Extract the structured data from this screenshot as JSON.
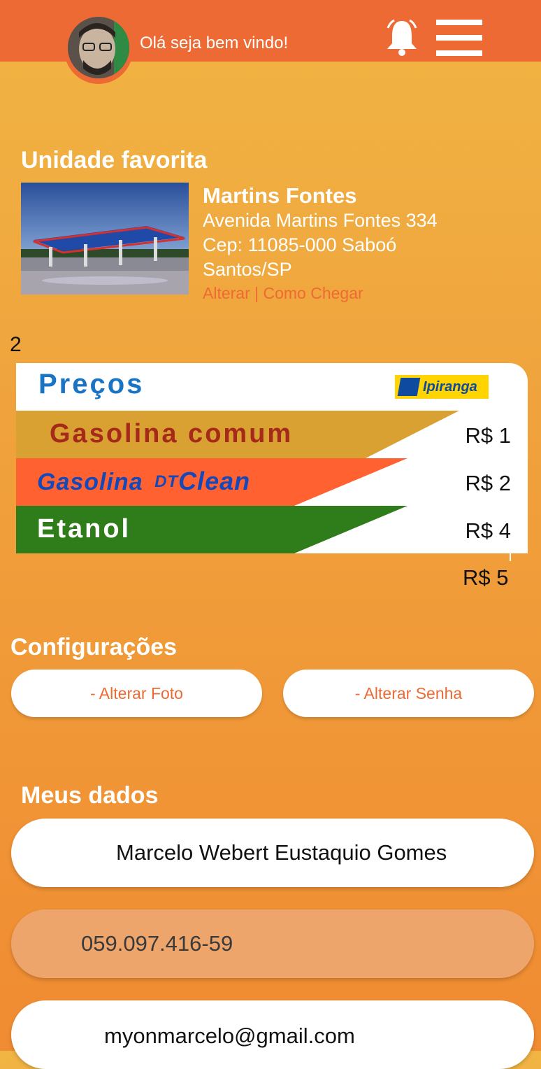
{
  "header": {
    "greeting": "Olá seja bem vindo!",
    "avatar_icon": "user-avatar",
    "bell_icon": "bell-icon",
    "menu_icon": "hamburger-menu-icon",
    "bar_color": "#ee6a34"
  },
  "favorite": {
    "section_title": "Unidade favorita",
    "name": "Martins Fontes",
    "address": "Avenida Martins Fontes 334",
    "cep": "Cep: 11085-000 Saboó",
    "city": "Santos/SP",
    "links": "Alterar | Como Chegar"
  },
  "stray_number": "2",
  "prices": {
    "title": "Preços",
    "brand": "Ipiranga",
    "rows": [
      {
        "label": "Gasolina comum",
        "price": "R$ 1",
        "color": "#d9a032",
        "text_color": "#a52a1a"
      },
      {
        "label_main": "Gasolina",
        "label_badge": "DT",
        "label_suffix": "Clean",
        "price": "R$ 2",
        "color": "#ff6230",
        "text_color": "#1548b8"
      },
      {
        "label": "Etanol",
        "price": "R$ 4",
        "color": "#2f7d1a",
        "text_color": "#ffffff"
      }
    ],
    "overflow_price": "R$ 5"
  },
  "settings": {
    "title": "Configurações",
    "change_photo": "- Alterar Foto",
    "change_password": "- Alterar Senha"
  },
  "my_data": {
    "title": "Meus dados",
    "name": "Marcelo Webert Eustaquio Gomes",
    "cpf": "059.097.416-59",
    "email": "myonmarcelo@gmail.com"
  }
}
